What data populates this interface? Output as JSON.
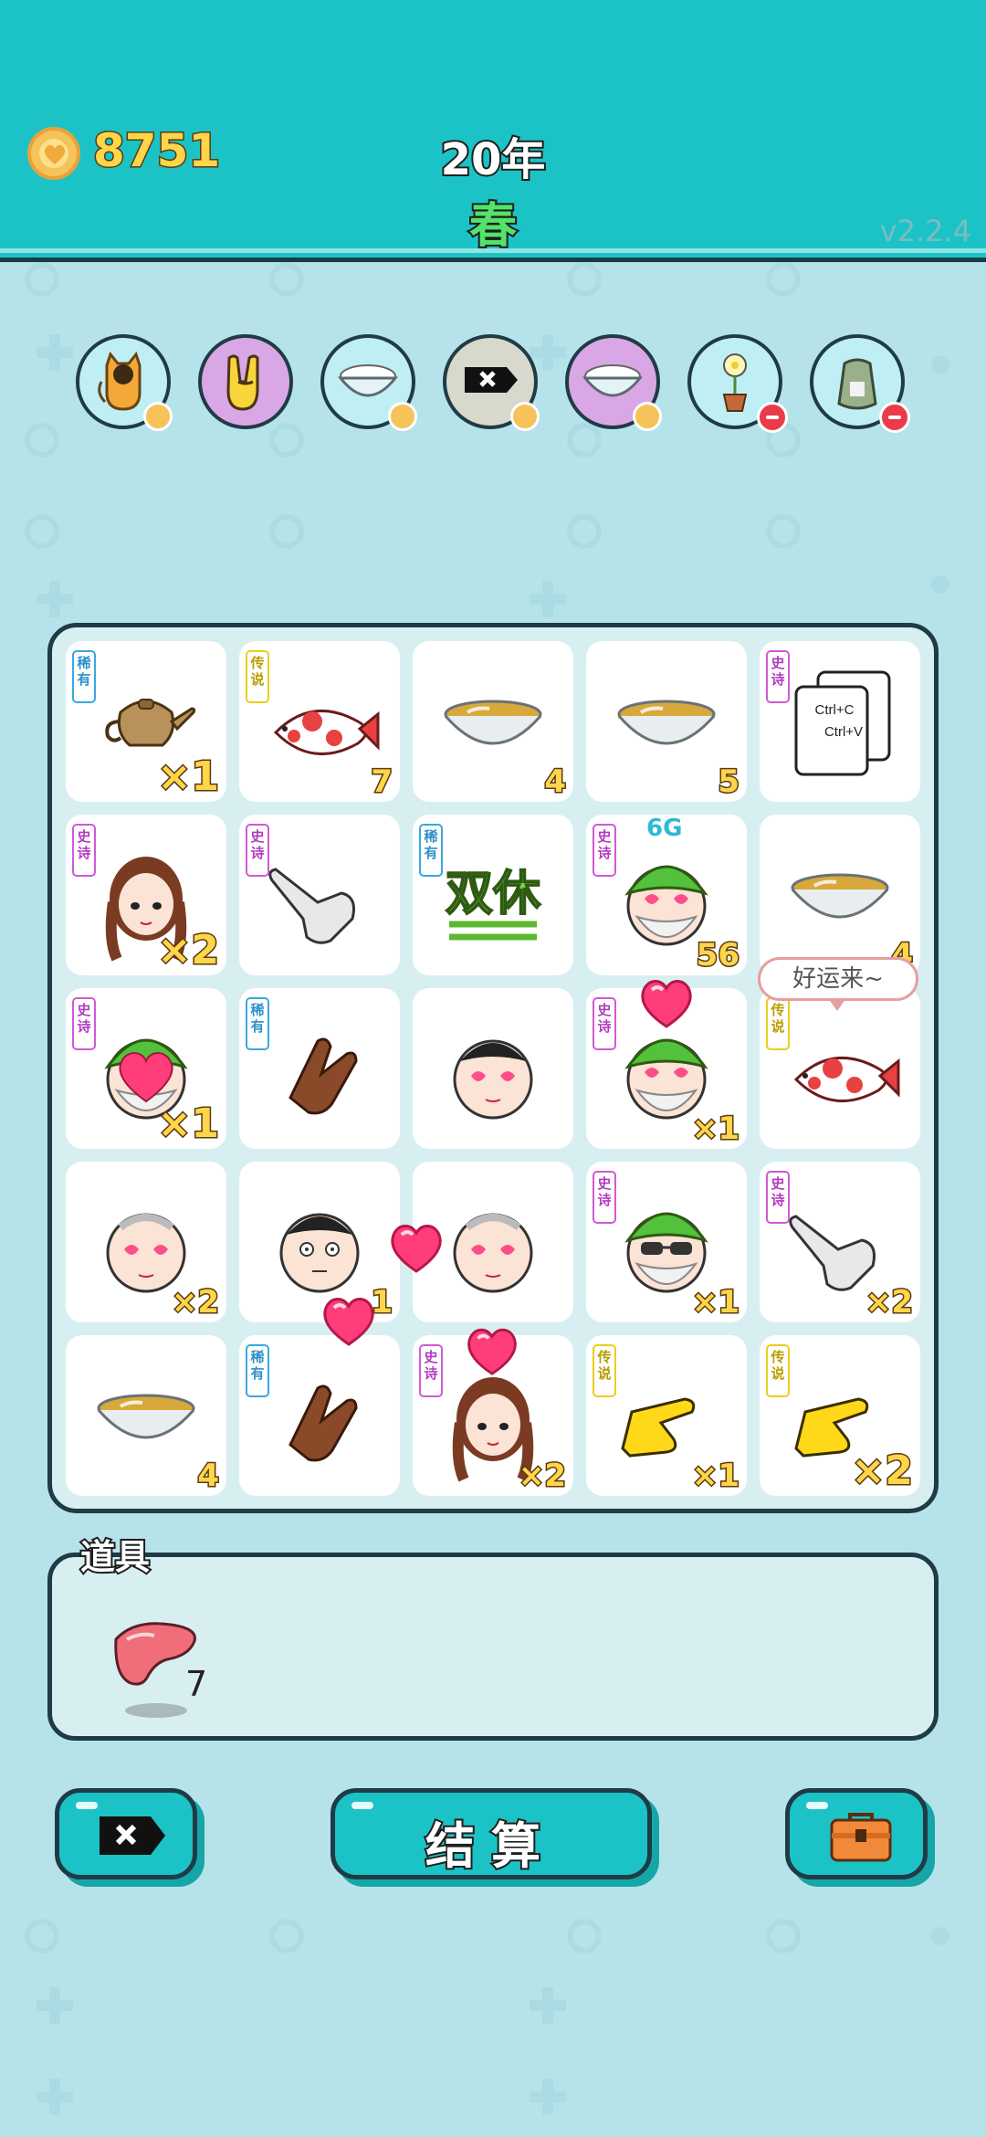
{
  "header": {
    "coins": "8751",
    "year": "20年",
    "season": "春",
    "version": "v2.2.4"
  },
  "top_items": [
    {
      "name": "cat",
      "badge": "heart"
    },
    {
      "name": "rock-hand",
      "badge": "heart"
    },
    {
      "name": "rice-bowl",
      "badge": "heart"
    },
    {
      "name": "delete-card",
      "badge": "heart"
    },
    {
      "name": "rice-bowl",
      "badge": "heart"
    },
    {
      "name": "flower-pot",
      "badge": "minus"
    },
    {
      "name": "rice-sack",
      "badge": "minus"
    }
  ],
  "rarity_labels": {
    "rare": "稀有",
    "epic": "史诗",
    "legend": "传说"
  },
  "board": {
    "cells": [
      {
        "item": "teapot",
        "rarity": "rare",
        "count": "×1"
      },
      {
        "item": "koi-fish",
        "rarity": "legend",
        "count": "7"
      },
      {
        "item": "tea-bowl",
        "rarity": "",
        "count": "4"
      },
      {
        "item": "tea-bowl",
        "rarity": "",
        "count": "5"
      },
      {
        "item": "ctrl-c-ctrl-v",
        "rarity": "epic",
        "count": "",
        "texts": [
          "Ctrl+C",
          "Ctrl+V"
        ]
      },
      {
        "item": "girl-braids",
        "rarity": "epic",
        "count": "×2"
      },
      {
        "item": "gray-hand-point",
        "rarity": "epic",
        "count": ""
      },
      {
        "item": "double-rest",
        "rarity": "rare",
        "count": "",
        "text": "双休"
      },
      {
        "item": "green-hat-man",
        "rarity": "epic",
        "count": "56",
        "tech": "6G"
      },
      {
        "item": "tea-bowl",
        "rarity": "",
        "count": "4"
      },
      {
        "item": "green-hat-man-heart",
        "rarity": "epic",
        "count": "×1"
      },
      {
        "item": "brown-hand",
        "rarity": "rare",
        "count": ""
      },
      {
        "item": "bald-man",
        "rarity": "",
        "count": ""
      },
      {
        "item": "green-hat-man",
        "rarity": "epic",
        "count": "×1"
      },
      {
        "item": "koi-fish",
        "rarity": "legend",
        "count": ""
      },
      {
        "item": "old-man",
        "rarity": "",
        "count": "×2"
      },
      {
        "item": "plain-man",
        "rarity": "",
        "count": "1"
      },
      {
        "item": "old-man",
        "rarity": "",
        "count": ""
      },
      {
        "item": "green-hat-sunglasses",
        "rarity": "epic",
        "count": "×1"
      },
      {
        "item": "gray-hand-point",
        "rarity": "epic",
        "count": "×2"
      },
      {
        "item": "tea-bowl",
        "rarity": "",
        "count": "4"
      },
      {
        "item": "brown-hand",
        "rarity": "rare",
        "count": ""
      },
      {
        "item": "girl-braids",
        "rarity": "epic",
        "count": "×2"
      },
      {
        "item": "yellow-hand",
        "rarity": "legend",
        "count": "×1"
      },
      {
        "item": "yellow-hand",
        "rarity": "legend",
        "count": "×2"
      }
    ],
    "bubble_text": "好运来~"
  },
  "items_panel": {
    "title": "道具",
    "liver_count": "7"
  },
  "buttons": {
    "settle": "结算"
  },
  "colors": {
    "header_bg": "#1cc3c6",
    "page_bg": "#b6e3ea",
    "coin_text": "#ffd54a",
    "season_text": "#53e36a"
  }
}
